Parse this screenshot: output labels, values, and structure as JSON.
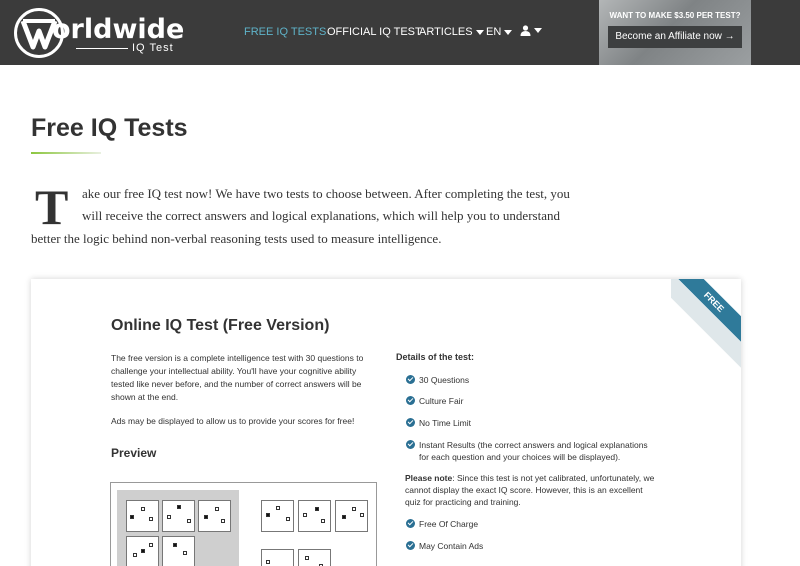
{
  "header": {
    "logo_text": "orldwide",
    "logo_sub": "IQ Test",
    "nav": {
      "free_iq_tests": "FREE IQ TESTS",
      "official_iq_test": "OFFICIAL IQ TEST",
      "articles": "ARTICLES",
      "language": "EN"
    },
    "affiliate": {
      "title": "WANT TO MAKE $3.50 PER TEST?",
      "button": "Become an Affiliate now →"
    },
    "colors": {
      "bar": "#3b3b3b",
      "active": "#5fb3c9"
    }
  },
  "page": {
    "title": "Free IQ Tests",
    "dropcap": "T",
    "intro_lines": [
      "ake our free IQ test now! We have two tests to choose between. After completing the test, you",
      "will receive the correct answers and logical explanations, which will help you to understand",
      "better the logic behind non-verbal reasoning tests used to measure intelligence."
    ]
  },
  "card": {
    "ribbon": "FREE",
    "title": "Online IQ Test (Free Version)",
    "description": "The free version is a complete intelligence test with 30 questions to challenge your intellectual ability. You'll have your cognitive ability tested like never before, and the number of correct answers will be shown at the end.",
    "note": "Ads may be displayed to allow us to provide your scores for free!",
    "preview_title": "Preview",
    "details_title": "Details of the test:",
    "details": [
      "30 Questions",
      "Culture Fair",
      "No Time Limit",
      "Instant Results (the correct answers and logical explanations",
      "for each question and your choices will be displayed)."
    ],
    "please_note_label": "Please note",
    "please_note_text": ": Since this test is not yet calibrated, unfortunately, we cannot display the exact IQ score. However, this is an excellent quiz for practicing and training.",
    "extras": [
      "Free Of Charge",
      "May Contain Ads"
    ],
    "colors": {
      "ribbon": "#2f7a9a",
      "check": "#2a6f93"
    }
  }
}
